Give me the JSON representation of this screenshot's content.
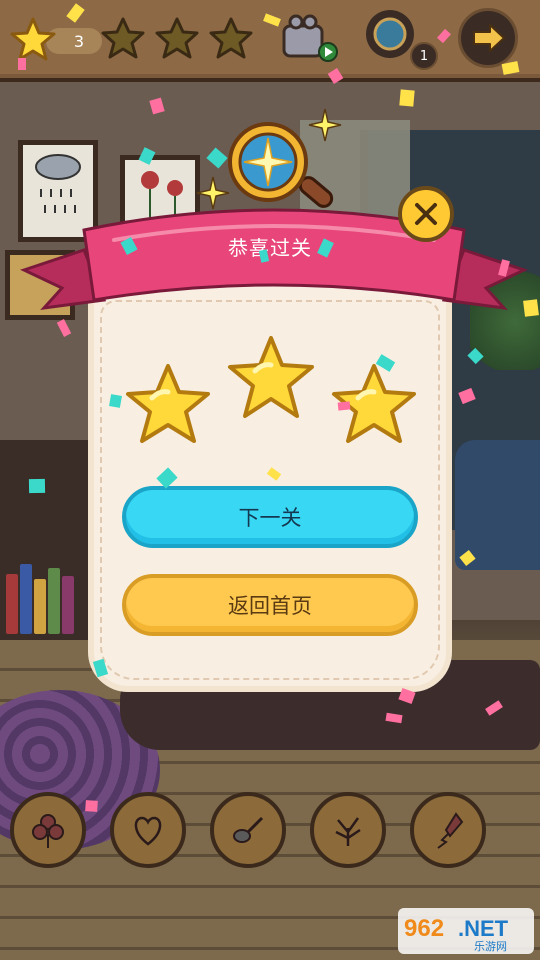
{
  "header": {
    "star_count": "3",
    "hint_badge": "1",
    "level_stars": [
      "star-outline",
      "star-outline",
      "star-outline"
    ]
  },
  "modal": {
    "title": "恭喜过关",
    "stars_earned": 3,
    "stars_total": 3,
    "next_button_label": "下一关",
    "home_button_label": "返回首页"
  },
  "tray": {
    "items": [
      "flower-icon",
      "heart-icon",
      "spoon-icon",
      "plant-icon",
      "kite-icon"
    ]
  },
  "watermark": {
    "brand_number": "962",
    "brand_suffix": ".NET",
    "subtitle": "乐游网"
  },
  "colors": {
    "ribbon": "#e8467a",
    "card": "#f8efe2",
    "next_button": "#38d8f5",
    "home_button": "#ffc94f",
    "star": "#ffd83a",
    "close_button": "#ffc934"
  }
}
